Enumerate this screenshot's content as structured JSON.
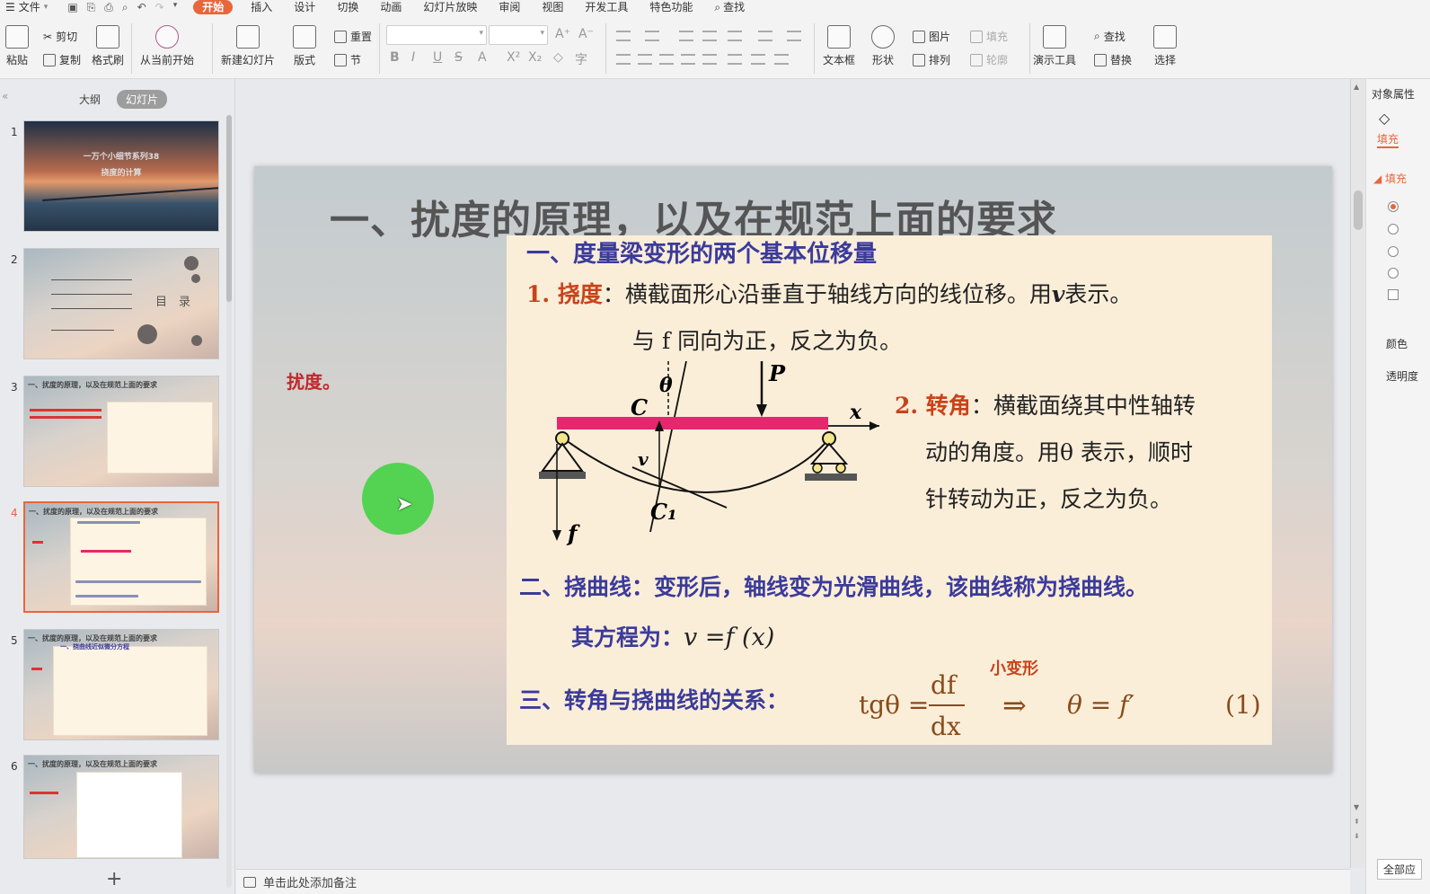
{
  "menubar": {
    "file": "文件",
    "tabs": [
      "开始",
      "插入",
      "设计",
      "切换",
      "动画",
      "幻灯片放映",
      "审阅",
      "视图",
      "开发工具",
      "特色功能"
    ],
    "active_tab": "开始",
    "find": "查找"
  },
  "ribbon": {
    "paste": "粘贴",
    "cut": "剪切",
    "copy": "复制",
    "format_painter": "格式刷",
    "from_current": "从当前开始",
    "new_slide": "新建幻灯片",
    "layout": "版式",
    "reset": "重置",
    "section": "节",
    "textbox": "文本框",
    "shape": "形状",
    "picture": "图片",
    "fill": "填充",
    "arrange": "排列",
    "outline": "轮廓",
    "present_tools": "演示工具",
    "find": "查找",
    "replace": "替换",
    "select": "选择"
  },
  "leftpanel": {
    "tab_outline": "大纲",
    "tab_slides": "幻灯片",
    "slides": [
      {
        "num": "1",
        "title": "一万个小细节系列38",
        "subtitle": "挠度的计算"
      },
      {
        "num": "2",
        "toc_label": "目　录"
      },
      {
        "num": "3",
        "title": "一、扰度的原理，以及在规范上面的要求"
      },
      {
        "num": "4",
        "title": "一、扰度的原理，以及在规范上面的要求"
      },
      {
        "num": "5",
        "title": "一、扰度的原理，以及在规范上面的要求",
        "sub": "一、挠曲线近似微分方程"
      },
      {
        "num": "6",
        "title": "一、扰度的原理，以及在规范上面的要求"
      }
    ],
    "add": "+"
  },
  "slide": {
    "title": "一、扰度的原理，以及在规范上面的要求",
    "side_note": "扰度。",
    "content": {
      "h1": "一、度量梁变形的两个基本位移量",
      "p1_label": "1. 挠度",
      "p1_text": "：横截面形心沿垂直于轴线方向的线位移。用",
      "p1_v": "v",
      "p1_end": "表示。",
      "p1_line2": "与 f 同向为正，反之为负。",
      "p2_label": "2. 转角",
      "p2_text": "：横截面绕其中性轴转",
      "p2_line2": "动的角度。用θ 表示，顺时",
      "p2_line3": "针转动为正，反之为负。",
      "h2": "二、挠曲线：变形后，轴线变为光滑曲线，该曲线称为挠曲线。",
      "eq_label": "其方程为：",
      "eq": "v =f (x)",
      "h3": "三、转角与挠曲线的关系：",
      "small_def": "小变形",
      "formula_lhs": "tgθ =",
      "formula_num": "df",
      "formula_den": "dx",
      "formula_arrow": "⇒",
      "formula_rhs": "θ = f′",
      "formula_no": "(1)",
      "diagram": {
        "P": "P",
        "x": "x",
        "C": "C",
        "theta": "θ",
        "v": "v",
        "C1": "C₁",
        "f": "f"
      }
    }
  },
  "rightpanel": {
    "title": "对象属性",
    "tab_fill": "填充",
    "section_fill": "填充",
    "color": "颜色",
    "transparency": "透明度",
    "apply_all": "全部应"
  },
  "notes": {
    "placeholder": "单击此处添加备注"
  },
  "colors": {
    "accent": "#e8663c",
    "beam": "#e8266e",
    "heading_blue": "#3b3b9b",
    "term_red": "#c8431b"
  }
}
